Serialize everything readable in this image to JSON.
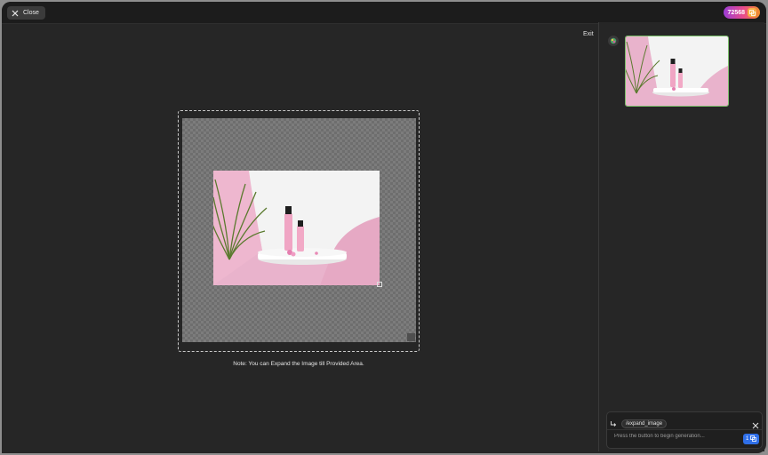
{
  "topbar": {
    "close_label": "Close",
    "credits": "72568",
    "credits_icon": "coins-icon"
  },
  "editor": {
    "exit_label": "Exit",
    "note": "Note: You can Expand the Image till Provided Area."
  },
  "prompt": {
    "command_chip": "/expand_image",
    "placeholder": "Press the button to begin generation...",
    "generate_cost": "1"
  },
  "colors": {
    "accent_blue": "#2f6fe8",
    "thumb_border": "#7bbf6a",
    "credits_gradient": [
      "#9b3dd6",
      "#e94b8a",
      "#f0902a"
    ]
  }
}
